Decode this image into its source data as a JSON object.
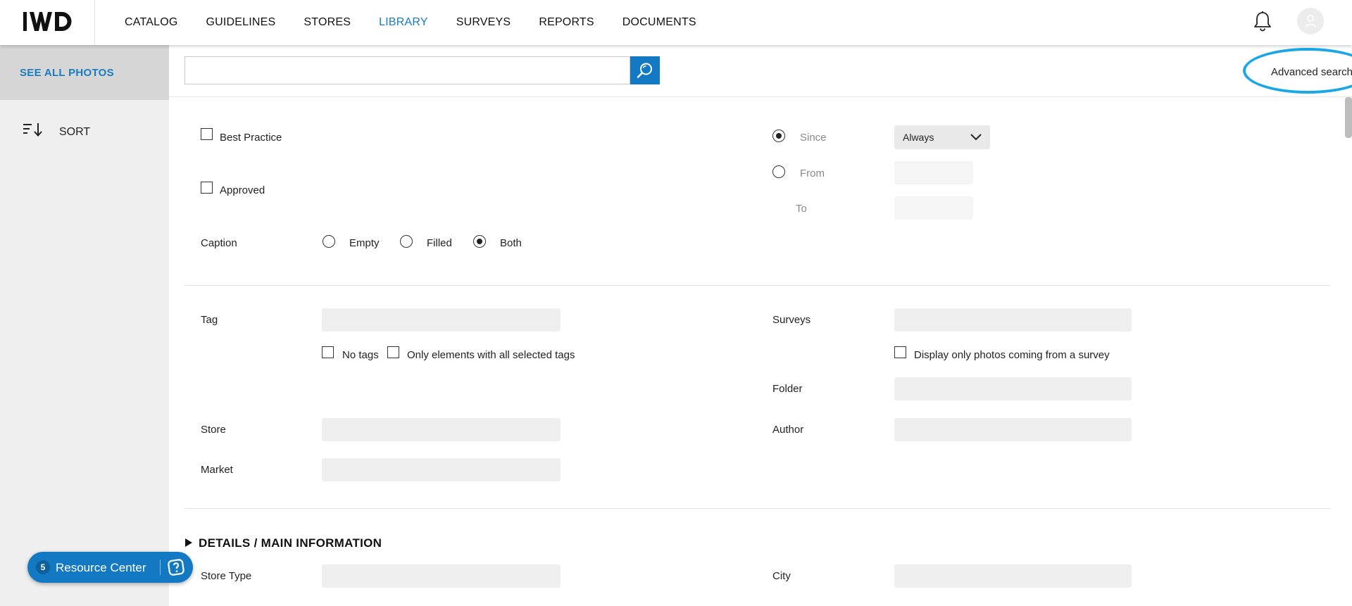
{
  "header": {
    "logo_text": "IWD",
    "nav": [
      {
        "label": "CATALOG",
        "active": false
      },
      {
        "label": "GUIDELINES",
        "active": false
      },
      {
        "label": "STORES",
        "active": false
      },
      {
        "label": "LIBRARY",
        "active": true
      },
      {
        "label": "SURVEYS",
        "active": false
      },
      {
        "label": "REPORTS",
        "active": false
      },
      {
        "label": "DOCUMENTS",
        "active": false
      }
    ],
    "icons": {
      "notifications": "bell-icon",
      "profile": "user-avatar-icon"
    }
  },
  "sidebar": {
    "see_all_label": "SEE ALL PHOTOS",
    "sort_label": "SORT",
    "resource_center": {
      "count": "5",
      "label": "Resource Center"
    }
  },
  "search": {
    "value": "",
    "button_icon": "search-icon",
    "advanced_label": "Advanced search"
  },
  "filters": {
    "best_practice": {
      "label": "Best Practice",
      "checked": false
    },
    "approved": {
      "label": "Approved",
      "checked": false
    },
    "caption": {
      "label": "Caption",
      "options": [
        {
          "label": "Empty",
          "selected": false
        },
        {
          "label": "Filled",
          "selected": false
        },
        {
          "label": "Both",
          "selected": true
        }
      ]
    },
    "date": {
      "since_label": "Since",
      "since_selected": true,
      "since_value": "Always",
      "from_label": "From",
      "from_selected": false,
      "to_label": "To"
    },
    "tag": {
      "label": "Tag",
      "no_tags_label": "No tags",
      "all_tags_label": "Only elements with all selected tags"
    },
    "surveys": {
      "label": "Surveys",
      "only_survey_label": "Display only photos coming from a survey"
    },
    "folder_label": "Folder",
    "store_label": "Store",
    "author_label": "Author",
    "market_label": "Market"
  },
  "details": {
    "title": "DETAILS / MAIN INFORMATION",
    "store_type_label": "Store Type",
    "city_label": "City"
  },
  "colors": {
    "accent": "#1479c3",
    "active_nav": "#1a7bc0",
    "highlight_ellipse": "#1aa7e8",
    "sidebar_bg": "#efefef"
  }
}
